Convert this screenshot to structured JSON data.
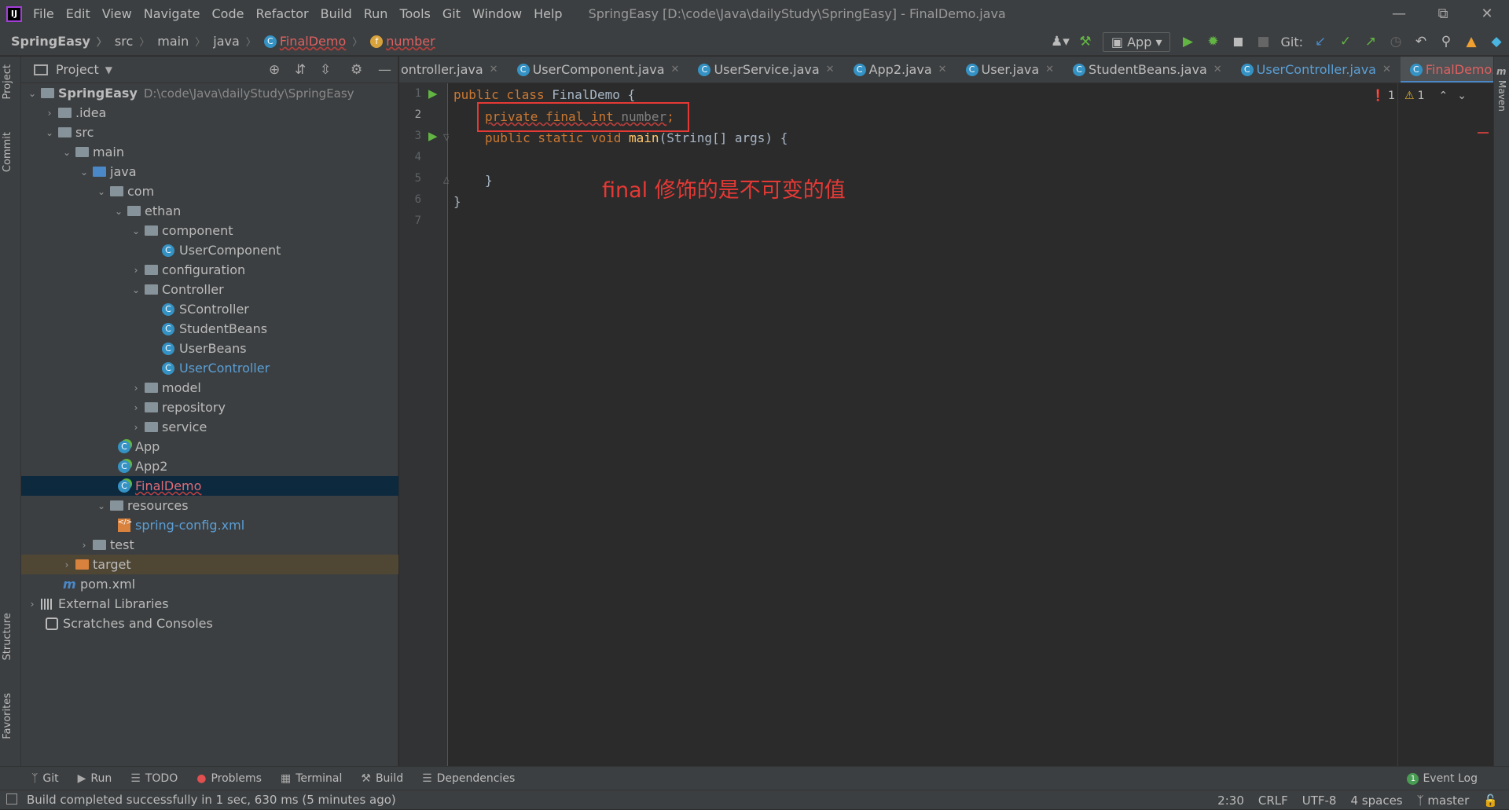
{
  "window": {
    "title": "SpringEasy [D:\\code\\Java\\dailyStudy\\SpringEasy] - FinalDemo.java",
    "menu": [
      "File",
      "Edit",
      "View",
      "Navigate",
      "Code",
      "Refactor",
      "Build",
      "Run",
      "Tools",
      "Git",
      "Window",
      "Help"
    ]
  },
  "breadcrumb": [
    "SpringEasy",
    "src",
    "main",
    "java",
    "FinalDemo",
    "number"
  ],
  "toolbar": {
    "run_config": "App",
    "git_label": "Git:"
  },
  "left_strip": {
    "project_tab": "Project",
    "commit_tab": "Commit",
    "structure_tab": "Structure",
    "favorites_tab": "Favorites"
  },
  "right_strip": {
    "maven_tab": "Maven"
  },
  "project_panel": {
    "title": "Project",
    "tree": [
      {
        "label": "SpringEasy",
        "path": "D:\\code\\Java\\dailyStudy\\SpringEasy"
      },
      {
        "label": ".idea"
      },
      {
        "label": "src"
      },
      {
        "label": "main"
      },
      {
        "label": "java"
      },
      {
        "label": "com"
      },
      {
        "label": "ethan"
      },
      {
        "label": "component"
      },
      {
        "label": "UserComponent"
      },
      {
        "label": "configuration"
      },
      {
        "label": "Controller"
      },
      {
        "label": "SController"
      },
      {
        "label": "StudentBeans"
      },
      {
        "label": "UserBeans"
      },
      {
        "label": "UserController"
      },
      {
        "label": "model"
      },
      {
        "label": "repository"
      },
      {
        "label": "service"
      },
      {
        "label": "App"
      },
      {
        "label": "App2"
      },
      {
        "label": "FinalDemo"
      },
      {
        "label": "resources"
      },
      {
        "label": "spring-config.xml"
      },
      {
        "label": "test"
      },
      {
        "label": "target"
      },
      {
        "label": "pom.xml"
      },
      {
        "label": "External Libraries"
      },
      {
        "label": "Scratches and Consoles"
      }
    ]
  },
  "editor_tabs": [
    {
      "label": "ontroller.java"
    },
    {
      "label": "UserComponent.java"
    },
    {
      "label": "UserService.java"
    },
    {
      "label": "App2.java"
    },
    {
      "label": "User.java"
    },
    {
      "label": "StudentBeans.java"
    },
    {
      "label": "UserController.java"
    },
    {
      "label": "FinalDemo.java"
    }
  ],
  "editor": {
    "line_numbers": [
      "1",
      "2",
      "3",
      "4",
      "5",
      "6",
      "7"
    ],
    "lines": {
      "l1_kw": "public class ",
      "l1_name": "FinalDemo",
      "l1_rest": " {",
      "l2_kw": "private final int ",
      "l2_field": "number",
      "l2_rest": ";",
      "l3_kw": "public static void ",
      "l3_fn": "main",
      "l3_rest": "(String[] args) {",
      "l5": "}",
      "l6": "}"
    },
    "annotation": "final 修饰的是不可变的值",
    "errors": "1",
    "warnings": "1"
  },
  "bottom_tools": [
    "Git",
    "Run",
    "TODO",
    "Problems",
    "Terminal",
    "Build",
    "Dependencies"
  ],
  "event_log": {
    "label": "Event Log",
    "count": "1"
  },
  "status": {
    "message": "Build completed successfully in 1 sec, 630 ms (5 minutes ago)",
    "position": "2:30",
    "line_sep": "CRLF",
    "encoding": "UTF-8",
    "indent": "4 spaces",
    "branch": "master"
  },
  "colors": {
    "accent": "#4a88c7",
    "error": "#e53935",
    "keyword": "#cc7832"
  }
}
